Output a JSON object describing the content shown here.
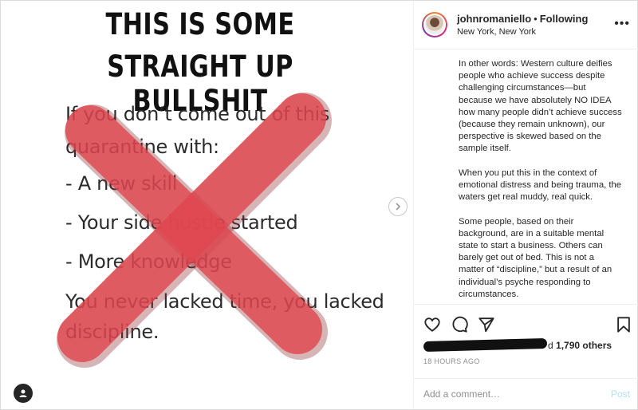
{
  "post_image": {
    "headline_line1": "THIS IS SOME",
    "headline_line2": "STRAIGHT UP BULLSHIT",
    "quote_lines": [
      "If you don’t come out of this",
      "quarantine with:",
      "- A new skill",
      "- Your side hustle started",
      "- More knowledge",
      "You never lacked time, you lacked",
      "discipline."
    ],
    "x_color": "#e0474f",
    "next_icon": "chevron-right-icon",
    "tag_icon": "user-tag-icon"
  },
  "header": {
    "username": "johnromaniello",
    "separator": "•",
    "follow_status": "Following",
    "location": "New York, New York",
    "more_icon": "•••"
  },
  "caption": {
    "paragraphs": [
      "In other words: Western culture deifies people who achieve success despite challenging circumstances—but because we have absolutely NO IDEA how many people didn’t achieve success (because they remain unknown), our perspective is skewed based on the sample itself.",
      "When you put this in the context of emotional distress and being trauma, the waters get real muddy, real quick.",
      "Some people, based on their background, are in a suitable mental state to start a business. Others can barely get out of bed. This is not a matter of “discipline,” but a result of an individual’s psyche responding to circumstances."
    ]
  },
  "actions": {
    "likes_suffix": "d ",
    "likes_count": "1,790 others",
    "timestamp": "18 HOURS AGO"
  },
  "comment": {
    "placeholder": "Add a comment…",
    "post_label": "Post"
  },
  "colors": {
    "post_button_disabled": "#b2dffc",
    "muted_text": "#8e8e8e"
  }
}
